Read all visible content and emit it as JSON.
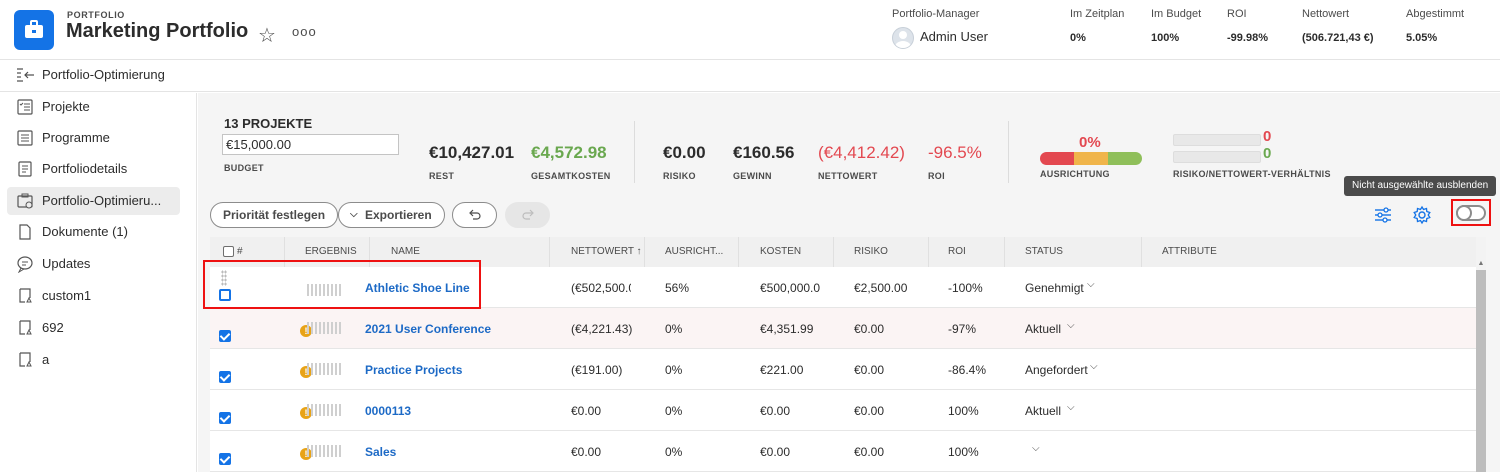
{
  "header": {
    "label": "PORTFOLIO",
    "title": "Marketing Portfolio",
    "more": "ooo",
    "stats": [
      {
        "label": "Portfolio-Manager",
        "value": "Admin User"
      },
      {
        "label": "Im Zeitplan",
        "value": "0%"
      },
      {
        "label": "Im Budget",
        "value": "100%"
      },
      {
        "label": "ROI",
        "value": "-99.98%"
      },
      {
        "label": "Nettowert",
        "value": "(506.721,43 €)"
      },
      {
        "label": "Abgestimmt",
        "value": "5.05%"
      }
    ]
  },
  "subheader": {
    "title": "Portfolio-Optimierung"
  },
  "sidebar": {
    "items": [
      {
        "label": "Projekte",
        "icon": "projects-icon"
      },
      {
        "label": "Programme",
        "icon": "programs-icon"
      },
      {
        "label": "Portfoliodetails",
        "icon": "details-icon"
      },
      {
        "label": "Portfolio-Optimieru...",
        "icon": "optimizer-icon"
      },
      {
        "label": "Dokumente (1)",
        "icon": "document-icon"
      },
      {
        "label": "Updates",
        "icon": "chat-icon"
      },
      {
        "label": "custom1",
        "icon": "custom-icon"
      },
      {
        "label": "692",
        "icon": "custom-icon"
      },
      {
        "label": "a",
        "icon": "custom-icon"
      }
    ]
  },
  "summary": {
    "count": "13 PROJEKTE",
    "budget_value": "€15,000.00",
    "budget_label": "BUDGET",
    "rest": {
      "value": "€10,427.01",
      "label": "REST"
    },
    "gesamtkosten": {
      "value": "€4,572.98",
      "label": "GESAMTKOSTEN"
    },
    "risiko": {
      "value": "€0.00",
      "label": "RISIKO"
    },
    "gewinn": {
      "value": "€160.56",
      "label": "GEWINN"
    },
    "nettowert": {
      "value": "(€4,412.42)",
      "label": "NETTOWERT"
    },
    "roi": {
      "value": "-96.5%",
      "label": "ROI"
    },
    "ausrichtung": {
      "value": "0%",
      "label": "AUSRICHTUNG"
    },
    "risk_ratio": {
      "label": "RISIKO/NETTOWERT-VERHÄLTNIS",
      "top": "0",
      "bottom": "0"
    }
  },
  "toolbar": {
    "priority": "Priorität festlegen",
    "export": "Exportieren",
    "tooltip": "Nicht ausgewählte ausblenden"
  },
  "table": {
    "columns": [
      "#",
      "ERGEBNIS",
      "NAME",
      "NETTOWERT ↑",
      "AUSRICHT...",
      "KOSTEN",
      "RISIKO",
      "ROI",
      "STATUS",
      "ATTRIBUTE"
    ],
    "rows": [
      {
        "name": "Athletic Shoe Line",
        "nettowert": "(€502,500.0",
        "ausrichtung": "56%",
        "kosten": "€500,000.0(",
        "risiko": "€2,500.00",
        "roi": "-100%",
        "status": "Genehmigt"
      },
      {
        "name": "2021 User Conference",
        "nettowert": "(€4,221.43)",
        "ausrichtung": "0%",
        "kosten": "€4,351.99",
        "risiko": "€0.00",
        "roi": "-97%",
        "status": "Aktuell"
      },
      {
        "name": "Practice Projects",
        "nettowert": "(€191.00)",
        "ausrichtung": "0%",
        "kosten": "€221.00",
        "risiko": "€0.00",
        "roi": "-86.4%",
        "status": "Angefordert"
      },
      {
        "name": "0000113",
        "nettowert": "€0.00",
        "ausrichtung": "0%",
        "kosten": "€0.00",
        "risiko": "€0.00",
        "roi": "100%",
        "status": "Aktuell"
      },
      {
        "name": "Sales",
        "nettowert": "€0.00",
        "ausrichtung": "0%",
        "kosten": "€0.00",
        "risiko": "€0.00",
        "roi": "100%",
        "status": ""
      }
    ]
  },
  "colors": {
    "accent": "#1473e6",
    "positive": "#6aa84f",
    "negative": "#e34850",
    "warning": "#e8a317"
  }
}
